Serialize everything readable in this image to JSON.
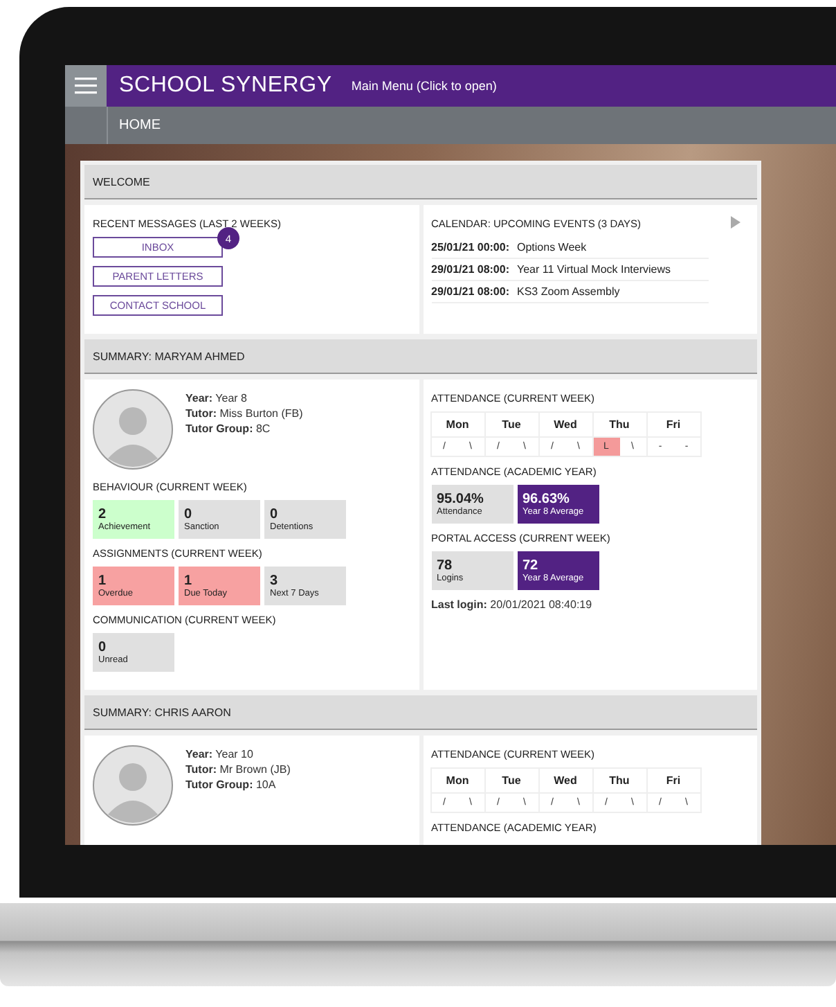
{
  "top_bar": {
    "logo": "SCHOOL SYNERGY",
    "menu_link": "Main Menu (Click to open)"
  },
  "breadcrumb": "HOME",
  "welcome": {
    "title": "WELCOME",
    "messages": {
      "title": "RECENT MESSAGES (LAST 2 WEEKS)",
      "buttons": [
        {
          "label": "INBOX",
          "badge": "4"
        },
        {
          "label": "PARENT LETTERS"
        },
        {
          "label": "CONTACT SCHOOL"
        }
      ]
    },
    "calendar": {
      "title": "CALENDAR: UPCOMING EVENTS (3 DAYS)",
      "events": [
        {
          "time": "25/01/21 00:00:",
          "name": "Options Week"
        },
        {
          "time": "29/01/21 08:00:",
          "name": "Year 11 Virtual Mock Interviews"
        },
        {
          "time": "29/01/21 08:00:",
          "name": "KS3 Zoom Assembly"
        }
      ]
    }
  },
  "students": [
    {
      "title": "SUMMARY: MARYAM AHMED",
      "details": [
        "**Year:** Year 8",
        "**Tutor:** Miss Burton (FB)",
        "**Tutor Group:** 8C"
      ],
      "left_sections": [
        {
          "kind": "tiles",
          "title": "BEHAVIOUR (CURRENT WEEK)",
          "tiles": [
            {
              "value": "2",
              "caption": "Achievement",
              "color": "#ccffcc"
            },
            {
              "value": "0",
              "caption": "Sanction",
              "color": "#e0e0e0"
            },
            {
              "value": "0",
              "caption": "Detentions",
              "color": "#e0e0e0"
            }
          ]
        },
        {
          "kind": "tiles",
          "title": "ASSIGNMENTS (CURRENT WEEK)",
          "tiles": [
            {
              "value": "1",
              "caption": "Overdue",
              "color": "#f7a1a1"
            },
            {
              "value": "1",
              "caption": "Due Today",
              "color": "#f7a1a1"
            },
            {
              "value": "3",
              "caption": "Next 7 Days",
              "color": "#e0e0e0"
            }
          ]
        },
        {
          "kind": "tiles",
          "title": "COMMUNICATION (CURRENT WEEK)",
          "tiles": [
            {
              "value": "0",
              "caption": "Unread",
              "color": "#e0e0e0"
            }
          ]
        }
      ],
      "right_sections": [
        {
          "kind": "week",
          "title": "ATTENDANCE (CURRENT WEEK)",
          "days": [
            {
              "label": "Mon",
              "marks": [
                {
                  "text": "/",
                  "flagged": false
                },
                {
                  "text": "\\",
                  "flagged": false
                }
              ]
            },
            {
              "label": "Tue",
              "marks": [
                {
                  "text": "/",
                  "flagged": false
                },
                {
                  "text": "\\",
                  "flagged": false
                }
              ]
            },
            {
              "label": "Wed",
              "marks": [
                {
                  "text": "/",
                  "flagged": false
                },
                {
                  "text": "\\",
                  "flagged": false
                }
              ]
            },
            {
              "label": "Thu",
              "marks": [
                {
                  "text": "L",
                  "flagged": true
                },
                {
                  "text": "\\",
                  "flagged": false
                }
              ]
            },
            {
              "label": "Fri",
              "marks": [
                {
                  "text": "-",
                  "flagged": false
                },
                {
                  "text": "-",
                  "flagged": false
                }
              ]
            }
          ]
        },
        {
          "kind": "tiles",
          "title": "ATTENDANCE (ACADEMIC YEAR)",
          "tiles": [
            {
              "value": "95.04%",
              "caption": "Attendance",
              "color": "#e0e0e0"
            },
            {
              "value": "96.63%",
              "caption": "Year 8 Average",
              "color": "#522283"
            }
          ]
        },
        {
          "kind": "tiles",
          "title": "PORTAL ACCESS (CURRENT WEEK)",
          "tiles": [
            {
              "value": "78",
              "caption": "Logins",
              "color": "#e0e0e0"
            },
            {
              "value": "72",
              "caption": "Year 8 Average",
              "color": "#522283"
            }
          ]
        },
        {
          "kind": "login",
          "text": "**Last login:** 20/01/2021 08:40:19"
        }
      ]
    },
    {
      "title": "SUMMARY: CHRIS AARON",
      "details": [
        "**Year:** Year 10",
        "**Tutor:** Mr Brown (JB)",
        "**Tutor Group:** 10A"
      ],
      "right_sections": [
        {
          "kind": "week",
          "title": "ATTENDANCE (CURRENT WEEK)",
          "days": [
            {
              "label": "Mon",
              "marks": [
                {
                  "text": "/",
                  "flagged": false
                },
                {
                  "text": "\\",
                  "flagged": false
                }
              ]
            },
            {
              "label": "Tue",
              "marks": [
                {
                  "text": "/",
                  "flagged": false
                },
                {
                  "text": "\\",
                  "flagged": false
                }
              ]
            },
            {
              "label": "Wed",
              "marks": [
                {
                  "text": "/",
                  "flagged": false
                },
                {
                  "text": "\\",
                  "flagged": false
                }
              ]
            },
            {
              "label": "Thu",
              "marks": [
                {
                  "text": "/",
                  "flagged": false
                },
                {
                  "text": "\\",
                  "flagged": false
                }
              ]
            },
            {
              "label": "Fri",
              "marks": [
                {
                  "text": "/",
                  "flagged": false
                },
                {
                  "text": "\\",
                  "flagged": false
                }
              ]
            }
          ]
        },
        {
          "kind": "heading",
          "title": "ATTENDANCE (ACADEMIC YEAR)"
        }
      ]
    }
  ]
}
